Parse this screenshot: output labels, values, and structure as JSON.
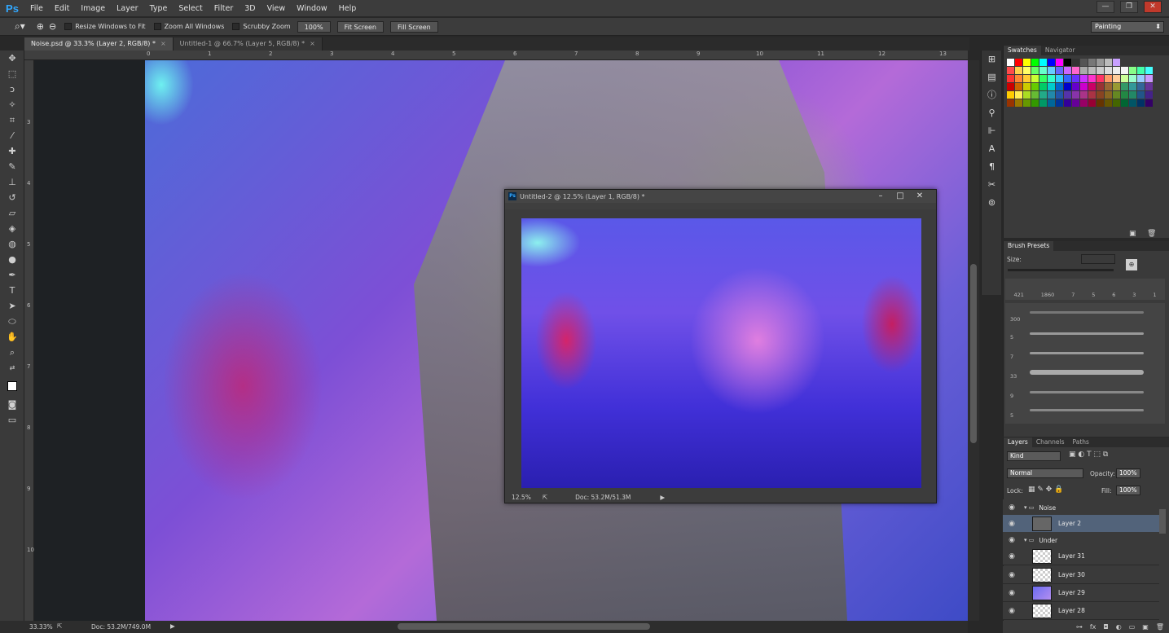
{
  "app": {
    "logo": "Ps"
  },
  "menu": [
    "File",
    "Edit",
    "Image",
    "Layer",
    "Type",
    "Select",
    "Filter",
    "3D",
    "View",
    "Window",
    "Help"
  ],
  "window_controls": [
    "—",
    "❐",
    "✕"
  ],
  "options": {
    "resize_windows": "Resize Windows to Fit",
    "zoom_all": "Zoom All Windows",
    "scrubby": "Scrubby Zoom",
    "zoom_100": "100%",
    "fit_screen": "Fit Screen",
    "fill_screen": "Fill Screen",
    "workspace": "Painting"
  },
  "tabs": [
    {
      "label": "Noise.psd @ 33.3% (Layer 2, RGB/8) *"
    },
    {
      "label": "Untitled-1 @ 66.7% (Layer 5, RGB/8) *"
    }
  ],
  "ruler_h": [
    "0",
    "1",
    "2",
    "3",
    "4",
    "5",
    "6",
    "7",
    "8",
    "9",
    "10",
    "11",
    "12",
    "13"
  ],
  "ruler_v": [
    "3",
    "4",
    "5",
    "6",
    "7",
    "8",
    "9",
    "10"
  ],
  "doc2": {
    "title": "Untitled-2 @ 12.5% (Layer 1, RGB/8) *",
    "zoom": "12.5%",
    "doc": "Doc: 53.2M/51.3M"
  },
  "status": {
    "zoom": "33.33%",
    "doc": "Doc: 53.2M/749.0M"
  },
  "swatches": {
    "tab1": "Swatches",
    "tab2": "Navigator"
  },
  "brush": {
    "title": "Brush Presets",
    "size_label": "Size:",
    "tip_sizes": [
      "421",
      "1860",
      "7",
      "5",
      "6",
      "3",
      "1"
    ],
    "stroke_sizes": [
      "300",
      "5",
      "7",
      "33",
      "9",
      "5"
    ]
  },
  "layers_panel": {
    "tabs": [
      "Layers",
      "Channels",
      "Paths"
    ],
    "kind": "Kind",
    "blend": "Normal",
    "opacity_label": "Opacity:",
    "opacity": "100%",
    "lock_label": "Lock:",
    "fill_label": "Fill:",
    "fill": "100%",
    "rows": [
      "Noise",
      "Layer 2",
      "Under",
      "Layer 31",
      "Layer 30",
      "Layer 29",
      "Layer 28"
    ]
  }
}
